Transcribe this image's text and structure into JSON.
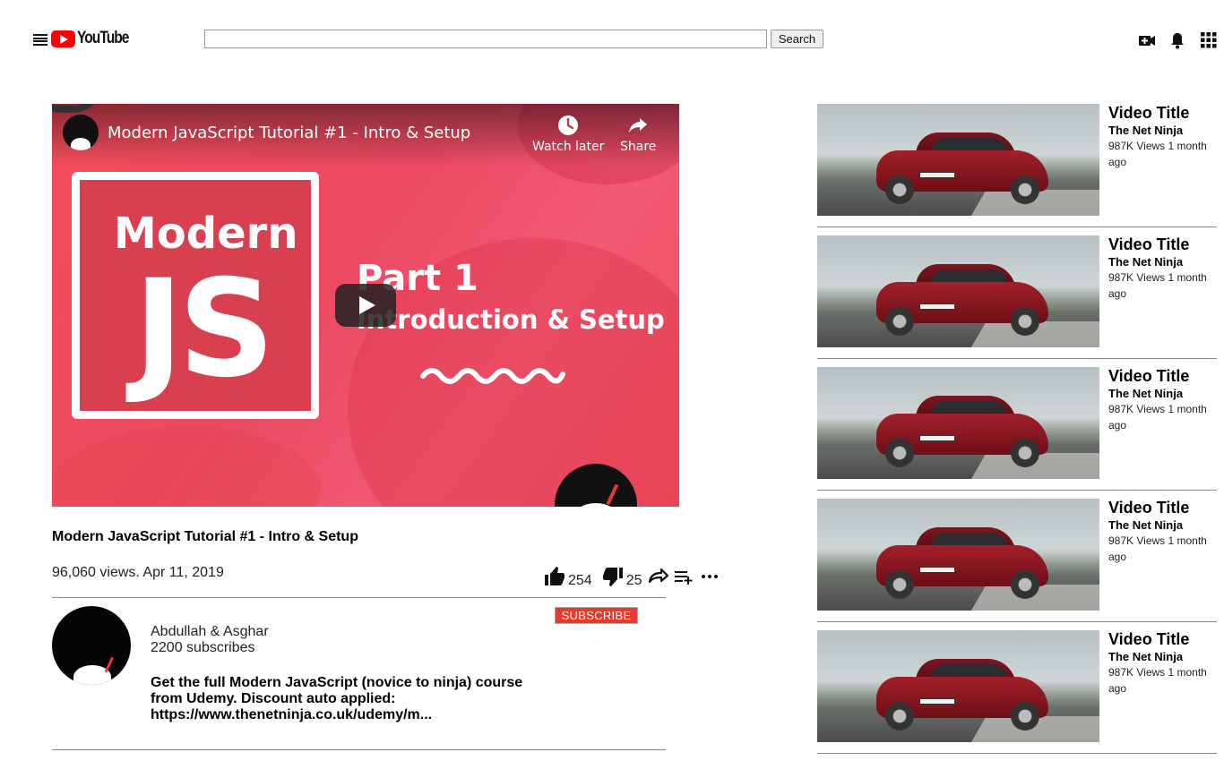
{
  "header": {
    "logo_text": "YouTube",
    "search_value": "",
    "search_button": "Search"
  },
  "player": {
    "overlay_title": "Modern JavaScript Tutorial #1 - Intro & Setup",
    "watch_later": "Watch later",
    "share": "Share",
    "thumb_modern": "Modern",
    "thumb_js": "JS",
    "thumb_part": "Part 1",
    "thumb_subtitle": "Introduction & Setup"
  },
  "video": {
    "title": "Modern JavaScript Tutorial #1 - Intro & Setup",
    "meta": "96,060 views. Apr 11, 2019",
    "likes": "254",
    "dislikes": "25"
  },
  "channel": {
    "name": "Abdullah & Asghar",
    "subscribers": "2200 subscribes",
    "subscribe_label": "SUBSCRIBE",
    "description": "Get the full Modern JavaScript (novice to ninja) course from Udemy. Discount auto applied: https://www.thenetninja.co.uk/udemy/m..."
  },
  "recommendations": [
    {
      "title": "Video Title",
      "channel": "The Net Ninja",
      "meta": "987K Views 1 month ago"
    },
    {
      "title": "Video Title",
      "channel": "The Net Ninja",
      "meta": "987K Views 1 month ago"
    },
    {
      "title": "Video Title",
      "channel": "The Net Ninja",
      "meta": "987K Views 1 month ago"
    },
    {
      "title": "Video Title",
      "channel": "The Net Ninja",
      "meta": "987K Views 1 month ago"
    },
    {
      "title": "Video Title",
      "channel": "The Net Ninja",
      "meta": "987K Views 1 month ago"
    }
  ],
  "colors": {
    "brand_red": "#ff0000",
    "subscribe_red": "#e53a2f",
    "thumbnail_pink": "#ef4b5e"
  },
  "icons": [
    "menu-icon",
    "youtube-logo-icon",
    "video-add-icon",
    "bell-icon",
    "apps-grid-icon",
    "clock-icon",
    "share-arrow-icon",
    "play-icon",
    "thumbs-up-icon",
    "thumbs-down-icon",
    "share-icon",
    "add-to-queue-icon",
    "more-icon"
  ]
}
